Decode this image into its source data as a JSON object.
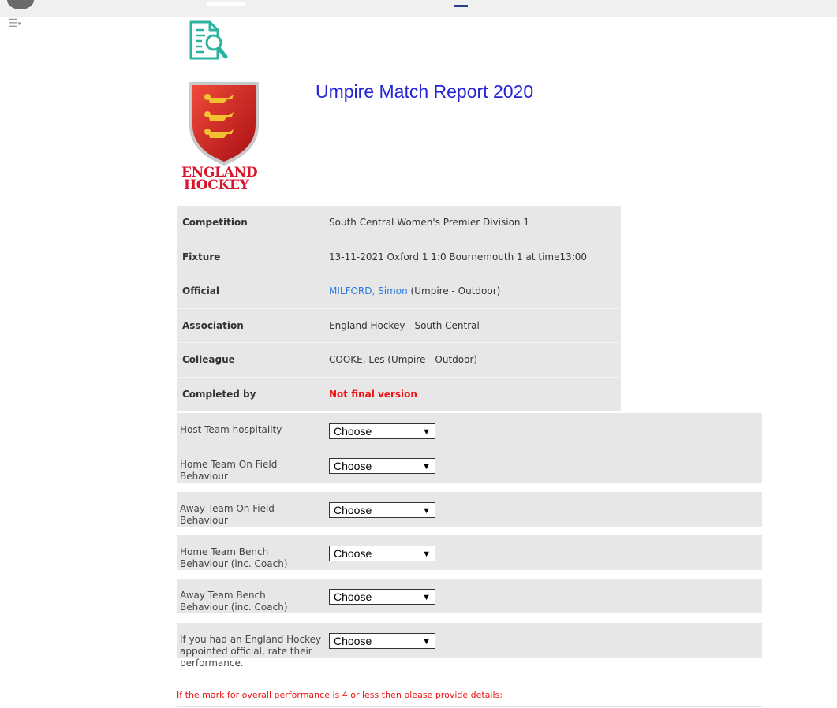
{
  "page": {
    "title": "Umpire Match Report 2020",
    "logo_text_line1": "ENGLAND",
    "logo_text_line2": "HOCKEY"
  },
  "details": {
    "rows": [
      {
        "label": "Competition",
        "value": "South Central Women's Premier Division 1"
      },
      {
        "label": "Fixture",
        "value": "13-11-2021 Oxford 1 1:0 Bournemouth 1 at time13:00"
      },
      {
        "label": "Official",
        "link": "MILFORD, Simon",
        "value": " (Umpire - Outdoor)"
      },
      {
        "label": "Association",
        "value": "England Hockey - South Central"
      },
      {
        "label": "Colleague",
        "value": "COOKE, Les (Umpire - Outdoor)"
      },
      {
        "label": "Completed by",
        "value": "Not final version"
      }
    ]
  },
  "questions": [
    {
      "label": "Host Team hospitality",
      "selected": "Choose"
    },
    {
      "label": "Home Team On Field Behaviour",
      "selected": "Choose"
    },
    {
      "label": "Away Team On Field Behaviour",
      "selected": "Choose"
    },
    {
      "label": "Home Team Bench Behaviour (inc. Coach)",
      "selected": "Choose"
    },
    {
      "label": "Away Team Bench Behaviour (inc. Coach)",
      "selected": "Choose"
    },
    {
      "label": "If you had an England Hockey appointed official, rate their performance.",
      "selected": "Choose"
    }
  ],
  "note": "If the mark for overall performance is 4 or less then please provide details:",
  "colors": {
    "title": "#2424d6",
    "link": "#2a7ae2",
    "warning": "#f01010",
    "logo_red": "#d9152b",
    "icon_teal": "#2bb3a0"
  },
  "icons": {
    "report": "document-search-icon",
    "menu": "hamburger-menu-icon",
    "dropdown": "chevron-down-icon"
  }
}
